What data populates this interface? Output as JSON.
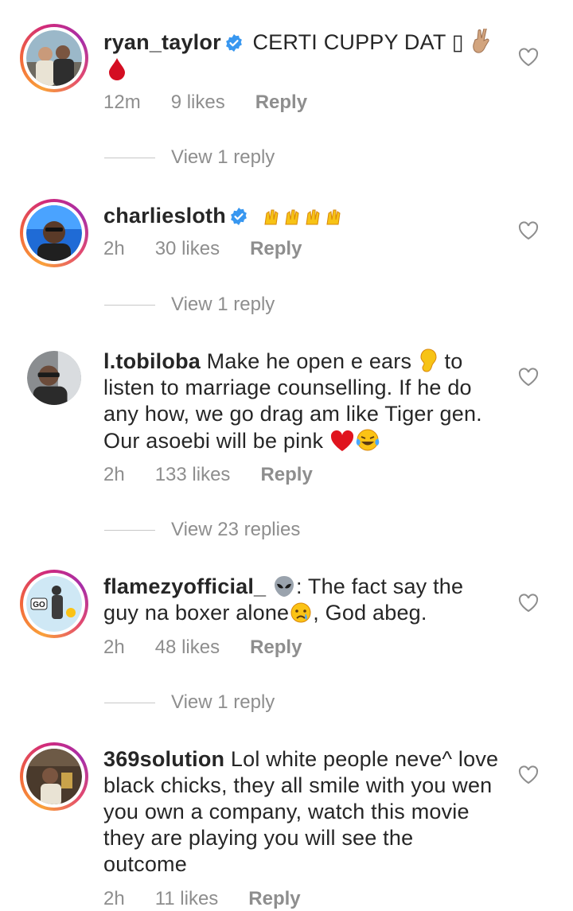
{
  "comments": [
    {
      "username": "ryan_taylor",
      "text": " CERTI CUPPY DAT ",
      "missing_glyph": "▯",
      "time": "12m",
      "likes": "9 likes",
      "reply": "Reply",
      "view_replies": "View 1 reply"
    },
    {
      "username": "charliesloth",
      "text": "",
      "time": "2h",
      "likes": "30 likes",
      "reply": "Reply",
      "view_replies": "View 1 reply"
    },
    {
      "username": "l.tobiloba",
      "text_1": " Make he open e ears ",
      "text_2": " to listen to marriage counselling. If he do any how, we go drag am like Tiger gen. Our asoebi will be pink ",
      "time": "2h",
      "likes": "133 likes",
      "reply": "Reply",
      "view_replies": "View 23 replies"
    },
    {
      "username": "flamezyofficial_",
      "text_1": ": The fact say the guy na boxer alone",
      "text_2": ", God abeg.",
      "time": "2h",
      "likes": "48 likes",
      "reply": "Reply",
      "view_replies": "View 1 reply"
    },
    {
      "username": "369solution",
      "text": " Lol white people neve^ love black chicks, they all smile with you wen you own a company, watch this movie they are playing you will see the outcome",
      "time": "2h",
      "likes": "11 likes",
      "reply": "Reply"
    }
  ],
  "icons": {
    "verified": "verified-badge-icon",
    "like": "heart-outline-icon",
    "avatar_text_4": "GO"
  },
  "colors": {
    "text": "#262626",
    "secondary": "#8e8e8e",
    "verified": "#3897f0",
    "divider": "#c7c7c7"
  }
}
